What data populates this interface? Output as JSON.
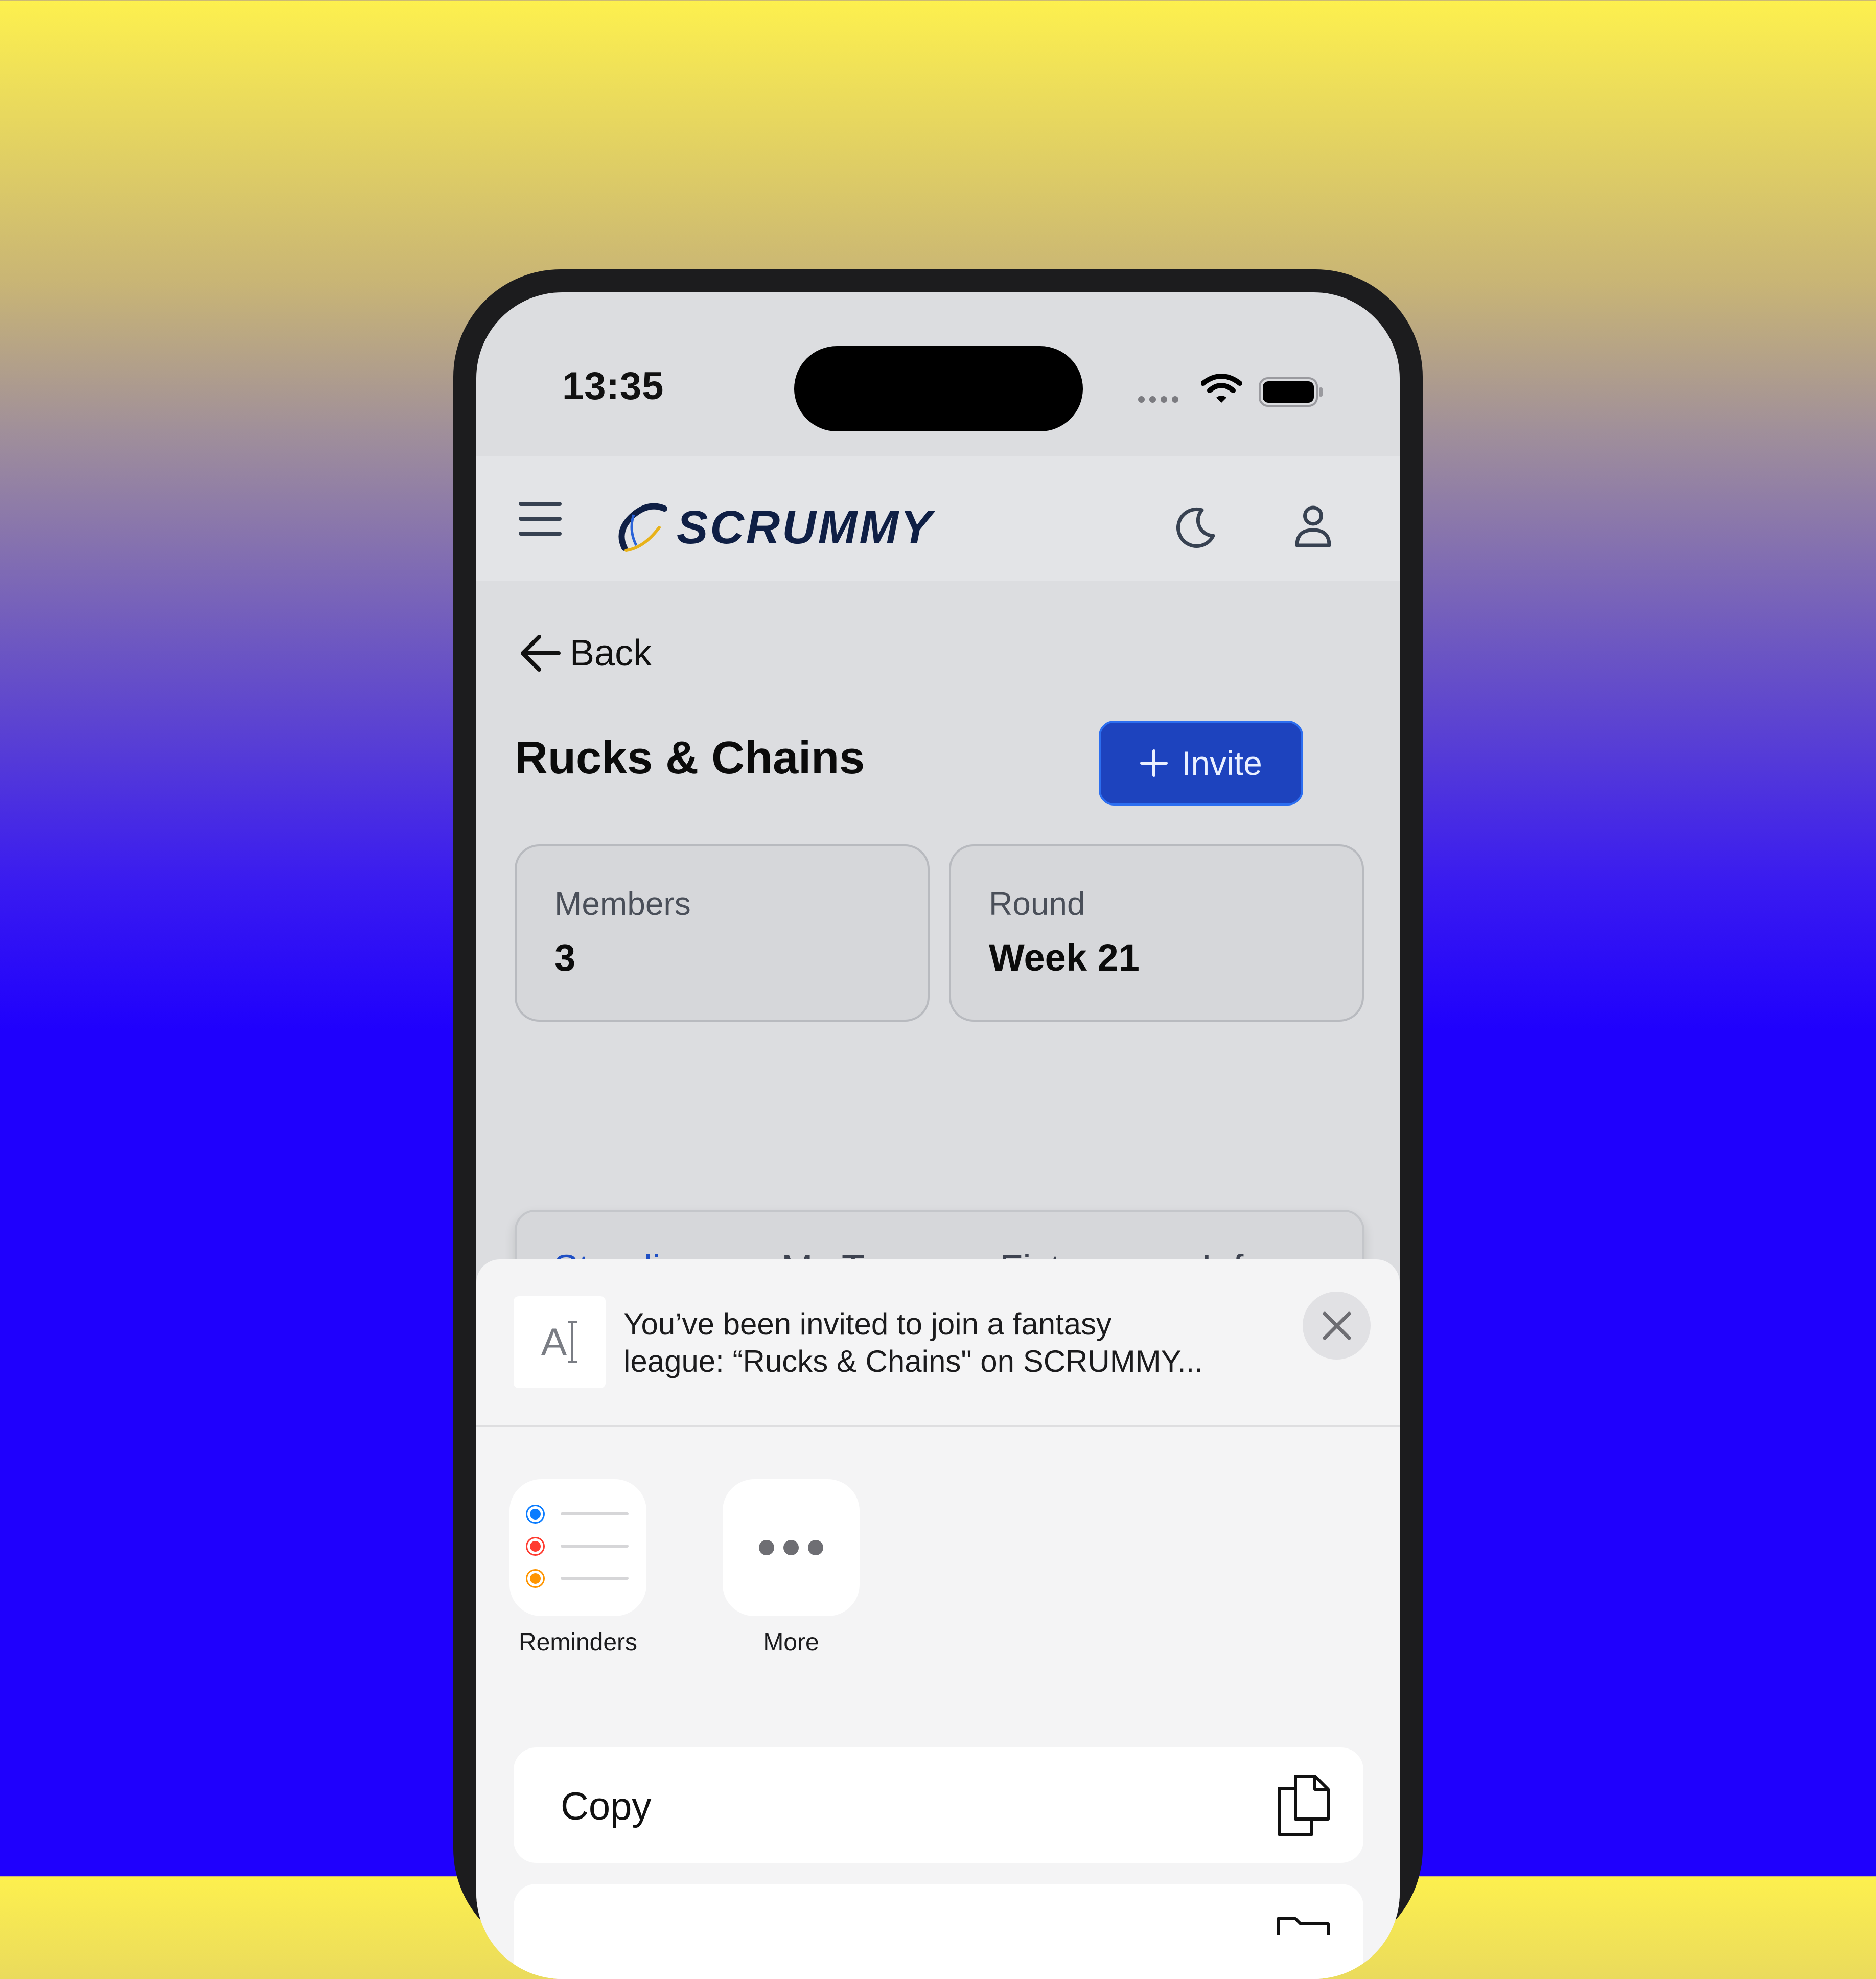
{
  "status_bar": {
    "time": "13:35"
  },
  "header": {
    "logo_text": "SCRUMMY"
  },
  "nav": {
    "back_label": "Back"
  },
  "league": {
    "title": "Rucks & Chains",
    "invite_label": "Invite",
    "stats": [
      {
        "label": "Members",
        "value": "3"
      },
      {
        "label": "Round",
        "value": "Week 21"
      }
    ],
    "tabs": [
      {
        "label": "Standings",
        "active": true
      },
      {
        "label": "My Team",
        "active": false
      },
      {
        "label": "Fixtures",
        "active": false
      },
      {
        "label": "Info",
        "active": false
      }
    ]
  },
  "share_sheet": {
    "preview_icon": "text-format-icon",
    "preview_glyph": "A",
    "message_line1": "You’ve been invited to join a fantasy",
    "message_line2": "league: “Rucks & Chains\" on SCRUMMY...",
    "apps": [
      {
        "label": "Reminders",
        "icon": "reminders-icon"
      },
      {
        "label": "More",
        "icon": "more-icon"
      }
    ],
    "actions": [
      {
        "label": "Copy",
        "icon": "copy-icon"
      }
    ]
  },
  "colors": {
    "accent": "#1d43be",
    "tab_active": "#1f4fc4",
    "logo": "#0f1f45"
  }
}
